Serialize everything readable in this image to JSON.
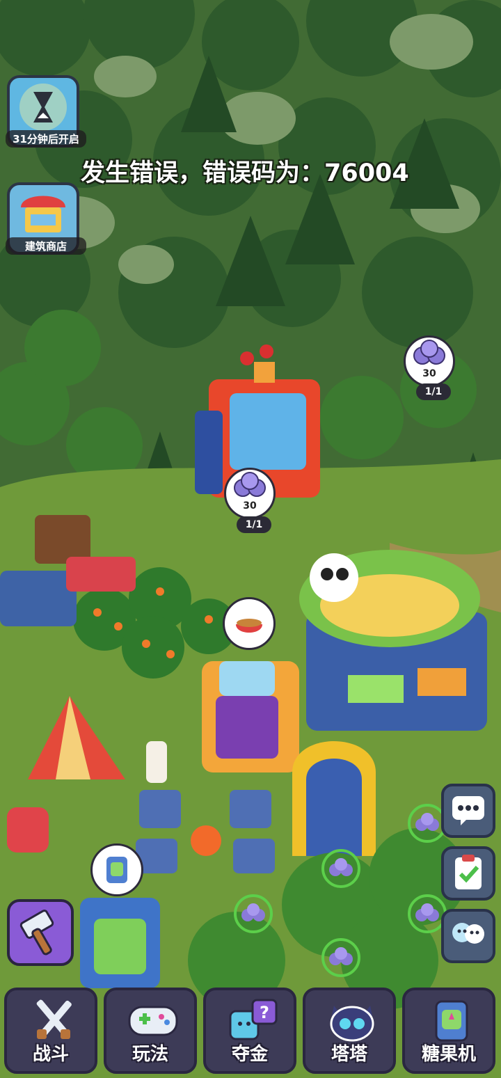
{
  "error_message": "发生错误，错误码为：76004",
  "side_buttons": {
    "timer_event": {
      "label": "31分钟后开启",
      "icon": "hourglass-icon"
    },
    "building_shop": {
      "label": "建筑商店",
      "icon": "shop-stall-icon"
    }
  },
  "bubbles": [
    {
      "value": "30",
      "counter": "1/1",
      "icon": "purple-orbs-icon"
    },
    {
      "value": "30",
      "counter": "1/1",
      "icon": "purple-orbs-icon"
    }
  ],
  "right_buttons": [
    {
      "icon": "chat-bubble-icon"
    },
    {
      "icon": "clipboard-check-icon"
    },
    {
      "icon": "friends-icon"
    }
  ],
  "bottom_nav": [
    {
      "label": "战斗",
      "icon": "crossed-swords-icon"
    },
    {
      "label": "玩法",
      "icon": "gamepad-icon"
    },
    {
      "label": "夺金",
      "icon": "mystery-box-icon"
    },
    {
      "label": "塔塔",
      "icon": "cat-mascot-icon"
    },
    {
      "label": "糖果机",
      "icon": "candy-machine-icon"
    }
  ],
  "colors": {
    "grass": "#6f9a3a",
    "forest": "#3f6b32",
    "nav_bg": "#3d3b57",
    "accent_purple": "#8a5bd6"
  }
}
